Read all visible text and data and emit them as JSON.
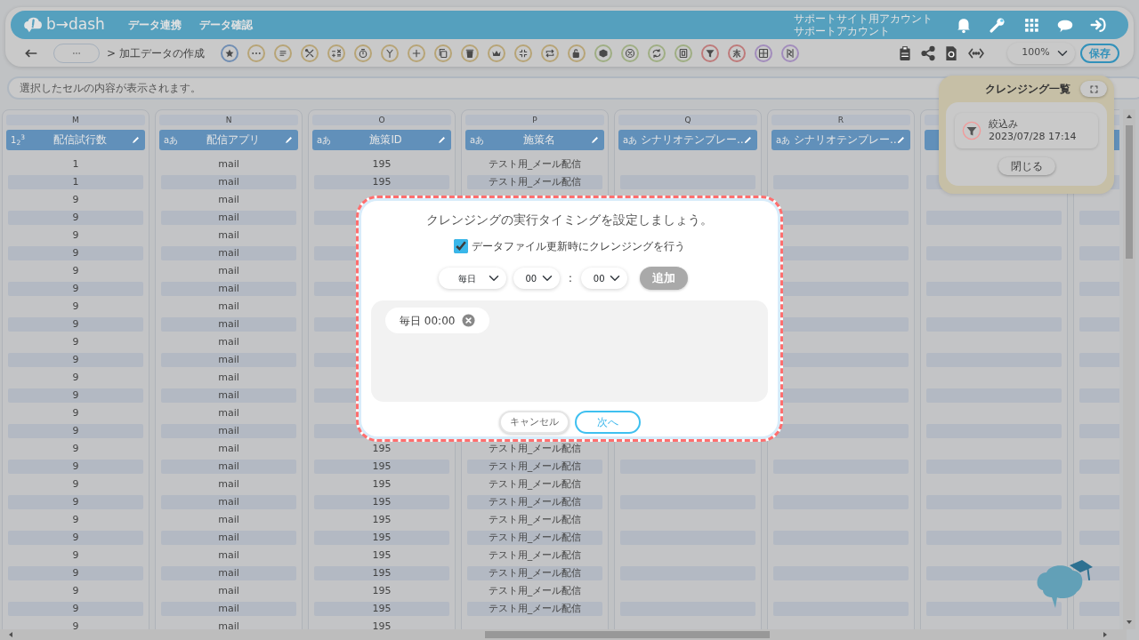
{
  "header": {
    "logo": "b→dash",
    "nav": [
      {
        "label": "データ連携"
      },
      {
        "label": "データ確認"
      }
    ],
    "account": [
      "サポートサイト用アカウント",
      "サポートアカウント"
    ]
  },
  "toolbar": {
    "breadcrumb": "> 加工データの作成",
    "tools": [
      {
        "color": "#718eb3"
      },
      {
        "color": "#b7a476"
      },
      {
        "color": "#b7a476"
      },
      {
        "color": "#b7a476"
      },
      {
        "color": "#b7a476"
      },
      {
        "color": "#b7a476"
      },
      {
        "color": "#b7a476"
      },
      {
        "color": "#b7a476"
      },
      {
        "color": "#b7a476"
      },
      {
        "color": "#b7a476"
      },
      {
        "color": "#b7a476"
      },
      {
        "color": "#b7a476"
      },
      {
        "color": "#b7a476"
      },
      {
        "color": "#b7a476"
      },
      {
        "color": "#9fae83"
      },
      {
        "color": "#9fae83"
      },
      {
        "color": "#9fae83"
      },
      {
        "color": "#9fae83"
      },
      {
        "color": "#be7a7a"
      },
      {
        "color": "#be7a7a"
      },
      {
        "color": "#a28cbc"
      },
      {
        "color": "#a28cbc"
      }
    ],
    "zoom": "100%",
    "save": "保存"
  },
  "cell_bar": {
    "placeholder": "選択したセルの内容が表示されます。"
  },
  "grid": {
    "columns": [
      {
        "letter": "M",
        "type_label": "1$_{2}$$^{3}$",
        "name": "配信試行数"
      },
      {
        "letter": "N",
        "type_label": "aあ",
        "name": "配信アプリ"
      },
      {
        "letter": "O",
        "type_label": "aあ",
        "name": "施策ID"
      },
      {
        "letter": "P",
        "type_label": "aあ",
        "name": "施策名"
      },
      {
        "letter": "Q",
        "type_label": "aあ",
        "name": "シナリオテンプレー…"
      },
      {
        "letter": "R",
        "type_label": "aあ",
        "name": "シナリオテンプレー…"
      },
      {},
      {}
    ],
    "rows": [
      {
        "cells": [
          "1",
          "mail",
          "195",
          "テスト用_メール配信"
        ]
      },
      {
        "cells": [
          "1",
          "mail",
          "195",
          "テスト用_メール配信"
        ]
      },
      {
        "cells": [
          "9",
          "mail"
        ]
      },
      {
        "cells": [
          "9",
          "mail"
        ]
      },
      {
        "cells": [
          "9",
          "mail"
        ]
      },
      {
        "cells": [
          "9",
          "mail"
        ]
      },
      {
        "cells": [
          "9",
          "mail"
        ]
      },
      {
        "cells": [
          "9",
          "mail"
        ]
      },
      {
        "cells": [
          "9",
          "mail"
        ]
      },
      {
        "cells": [
          "9",
          "mail"
        ]
      },
      {
        "cells": [
          "9",
          "mail"
        ]
      },
      {
        "cells": [
          "9",
          "mail"
        ]
      },
      {
        "cells": [
          "9",
          "mail"
        ]
      },
      {
        "cells": [
          "9",
          "mail"
        ]
      },
      {
        "cells": [
          "9",
          "mail"
        ]
      },
      {
        "cells": [
          "9",
          "mail"
        ]
      },
      {
        "cells": [
          "9",
          "mail",
          "195",
          "テスト用_メール配信"
        ]
      },
      {
        "cells": [
          "9",
          "mail",
          "195",
          "テスト用_メール配信"
        ]
      },
      {
        "cells": [
          "9",
          "mail",
          "195",
          "テスト用_メール配信"
        ]
      },
      {
        "cells": [
          "9",
          "mail",
          "195",
          "テスト用_メール配信"
        ]
      },
      {
        "cells": [
          "9",
          "mail",
          "195",
          "テスト用_メール配信"
        ]
      },
      {
        "cells": [
          "9",
          "mail",
          "195",
          "テスト用_メール配信"
        ]
      },
      {
        "cells": [
          "9",
          "mail",
          "195",
          "テスト用_メール配信"
        ]
      },
      {
        "cells": [
          "9",
          "mail",
          "195",
          "テスト用_メール配信"
        ]
      },
      {
        "cells": [
          "9",
          "mail",
          "195",
          "テスト用_メール配信"
        ]
      },
      {
        "cells": [
          "9",
          "mail",
          "195",
          "テスト用_メール配信"
        ]
      },
      {
        "cells": [
          "9",
          "mail",
          "195"
        ]
      }
    ]
  },
  "panel": {
    "title": "クレンジング一覧",
    "items": [
      {
        "label": "絞込み",
        "time": "2023/07/28 17:14"
      }
    ],
    "close": "閉じる"
  },
  "dialog": {
    "title": "クレンジングの実行タイミングを設定しましょう。",
    "on_update": {
      "label": "データファイル更新時にクレンジングを行う",
      "checked": true
    },
    "schedule": {
      "frequency": "毎日",
      "hour": "00",
      "separator": ":",
      "minute": "00",
      "add": {
        "label": "追加",
        "disabled": true
      }
    },
    "entries": [
      {
        "label": "毎日 00:00"
      }
    ],
    "cancel": "キャンセル",
    "next": "次へ"
  }
}
